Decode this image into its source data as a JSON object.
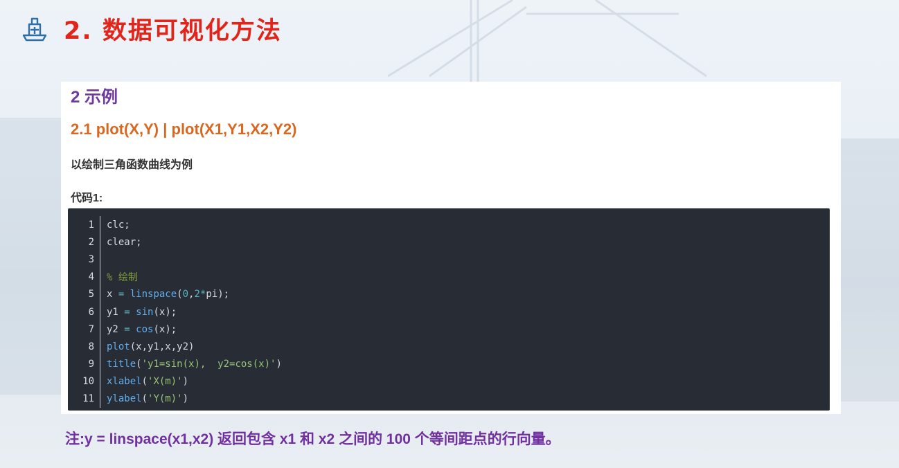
{
  "header": {
    "title": "2. 数据可视化方法",
    "icon": "ship-icon"
  },
  "section": {
    "heading": "2 示例",
    "subheading": "2.1 plot(X,Y) | plot(X1,Y1,X2,Y2)",
    "description": "以绘制三角函数曲线为例",
    "code_label": "代码1:"
  },
  "code": {
    "lines": [
      {
        "n": "1",
        "text": "clc;"
      },
      {
        "n": "2",
        "text": "clear;"
      },
      {
        "n": "3",
        "text": ""
      },
      {
        "n": "4",
        "text": "% 绘制"
      },
      {
        "n": "5",
        "text": "x = linspace(0,2*pi);"
      },
      {
        "n": "6",
        "text": "y1 = sin(x);"
      },
      {
        "n": "7",
        "text": "y2 = cos(x);"
      },
      {
        "n": "8",
        "text": "plot(x,y1,x,y2)"
      },
      {
        "n": "9",
        "text": "title('y1=sin(x),  y2=cos(x)')"
      },
      {
        "n": "10",
        "text": "xlabel('X(m)')"
      },
      {
        "n": "11",
        "text": "ylabel('Y(m)')"
      }
    ]
  },
  "note": "注:y = linspace(x1,x2) 返回包含 x1 和 x2 之间的 100 个等间距点的行向量。",
  "colors": {
    "title_red": "#e1251b",
    "heading_purple": "#6f3aa0",
    "subheading_orange": "#d9671f",
    "code_bg": "#282c34",
    "note_purple": "#7030a0"
  }
}
